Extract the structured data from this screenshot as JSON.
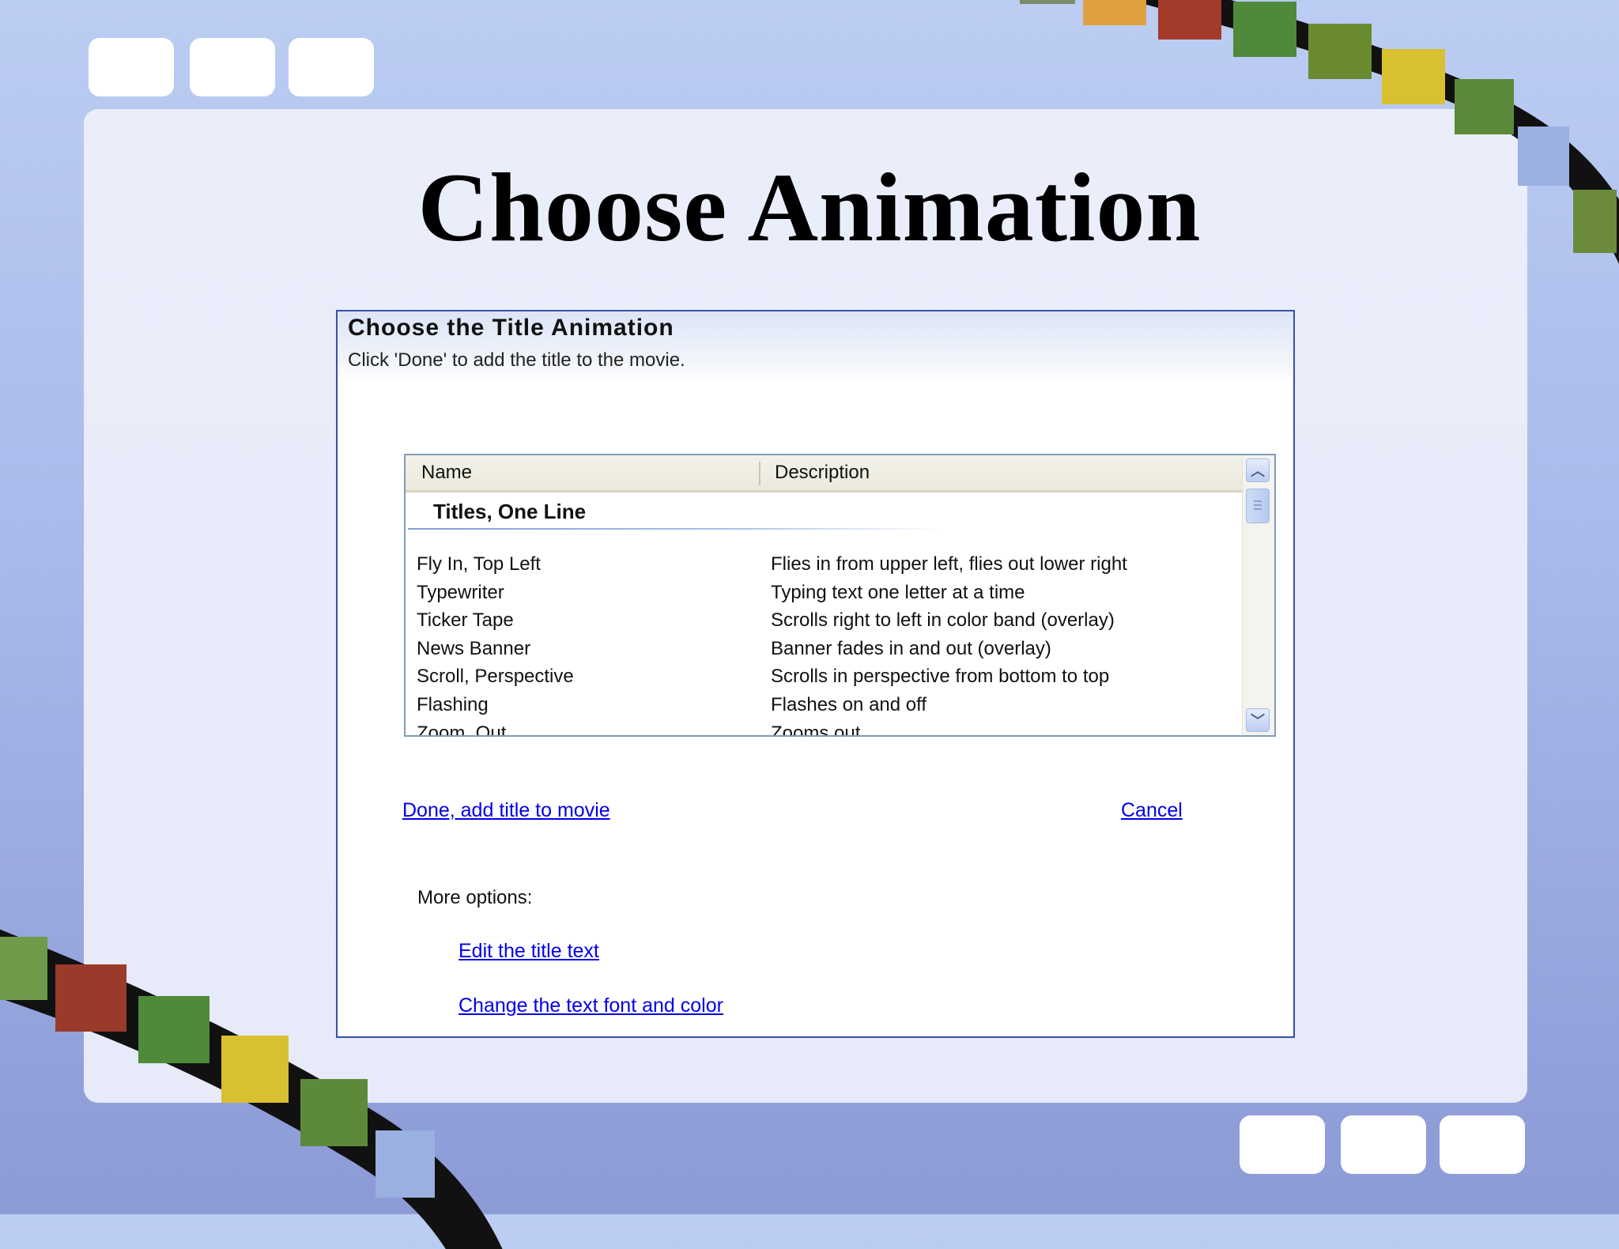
{
  "slide": {
    "title": "Choose Animation"
  },
  "dialog": {
    "title": "Choose the Title Animation",
    "subtitle": "Click 'Done' to add the title to the movie.",
    "list": {
      "columns": [
        "Name",
        "Description"
      ],
      "group": "Titles, One Line",
      "rows": [
        {
          "name": "Fly In, Top Left",
          "description": "Flies in from upper left, flies out lower right"
        },
        {
          "name": "Typewriter",
          "description": "Typing text one letter at a time"
        },
        {
          "name": "Ticker Tape",
          "description": "Scrolls right to left in color band (overlay)"
        },
        {
          "name": "News Banner",
          "description": "Banner fades in and out (overlay)"
        },
        {
          "name": "Scroll, Perspective",
          "description": "Scrolls in perspective from bottom to top"
        },
        {
          "name": "Flashing",
          "description": "Flashes on and off"
        },
        {
          "name": "Zoom, Out",
          "description": "Zooms out"
        }
      ]
    },
    "done_link": "Done, add title to movie",
    "cancel_link": "Cancel",
    "more_options_label": "More options:",
    "edit_link": "Edit the title text",
    "font_link": "Change the text font and color"
  },
  "colors": {
    "link": "#0000e6",
    "dialog_border": "#3a4fa8",
    "background_top": "#bccdf3",
    "background_bottom": "#8c9ad6"
  },
  "icons": [
    "scroll-up-icon",
    "scroll-down-icon"
  ]
}
